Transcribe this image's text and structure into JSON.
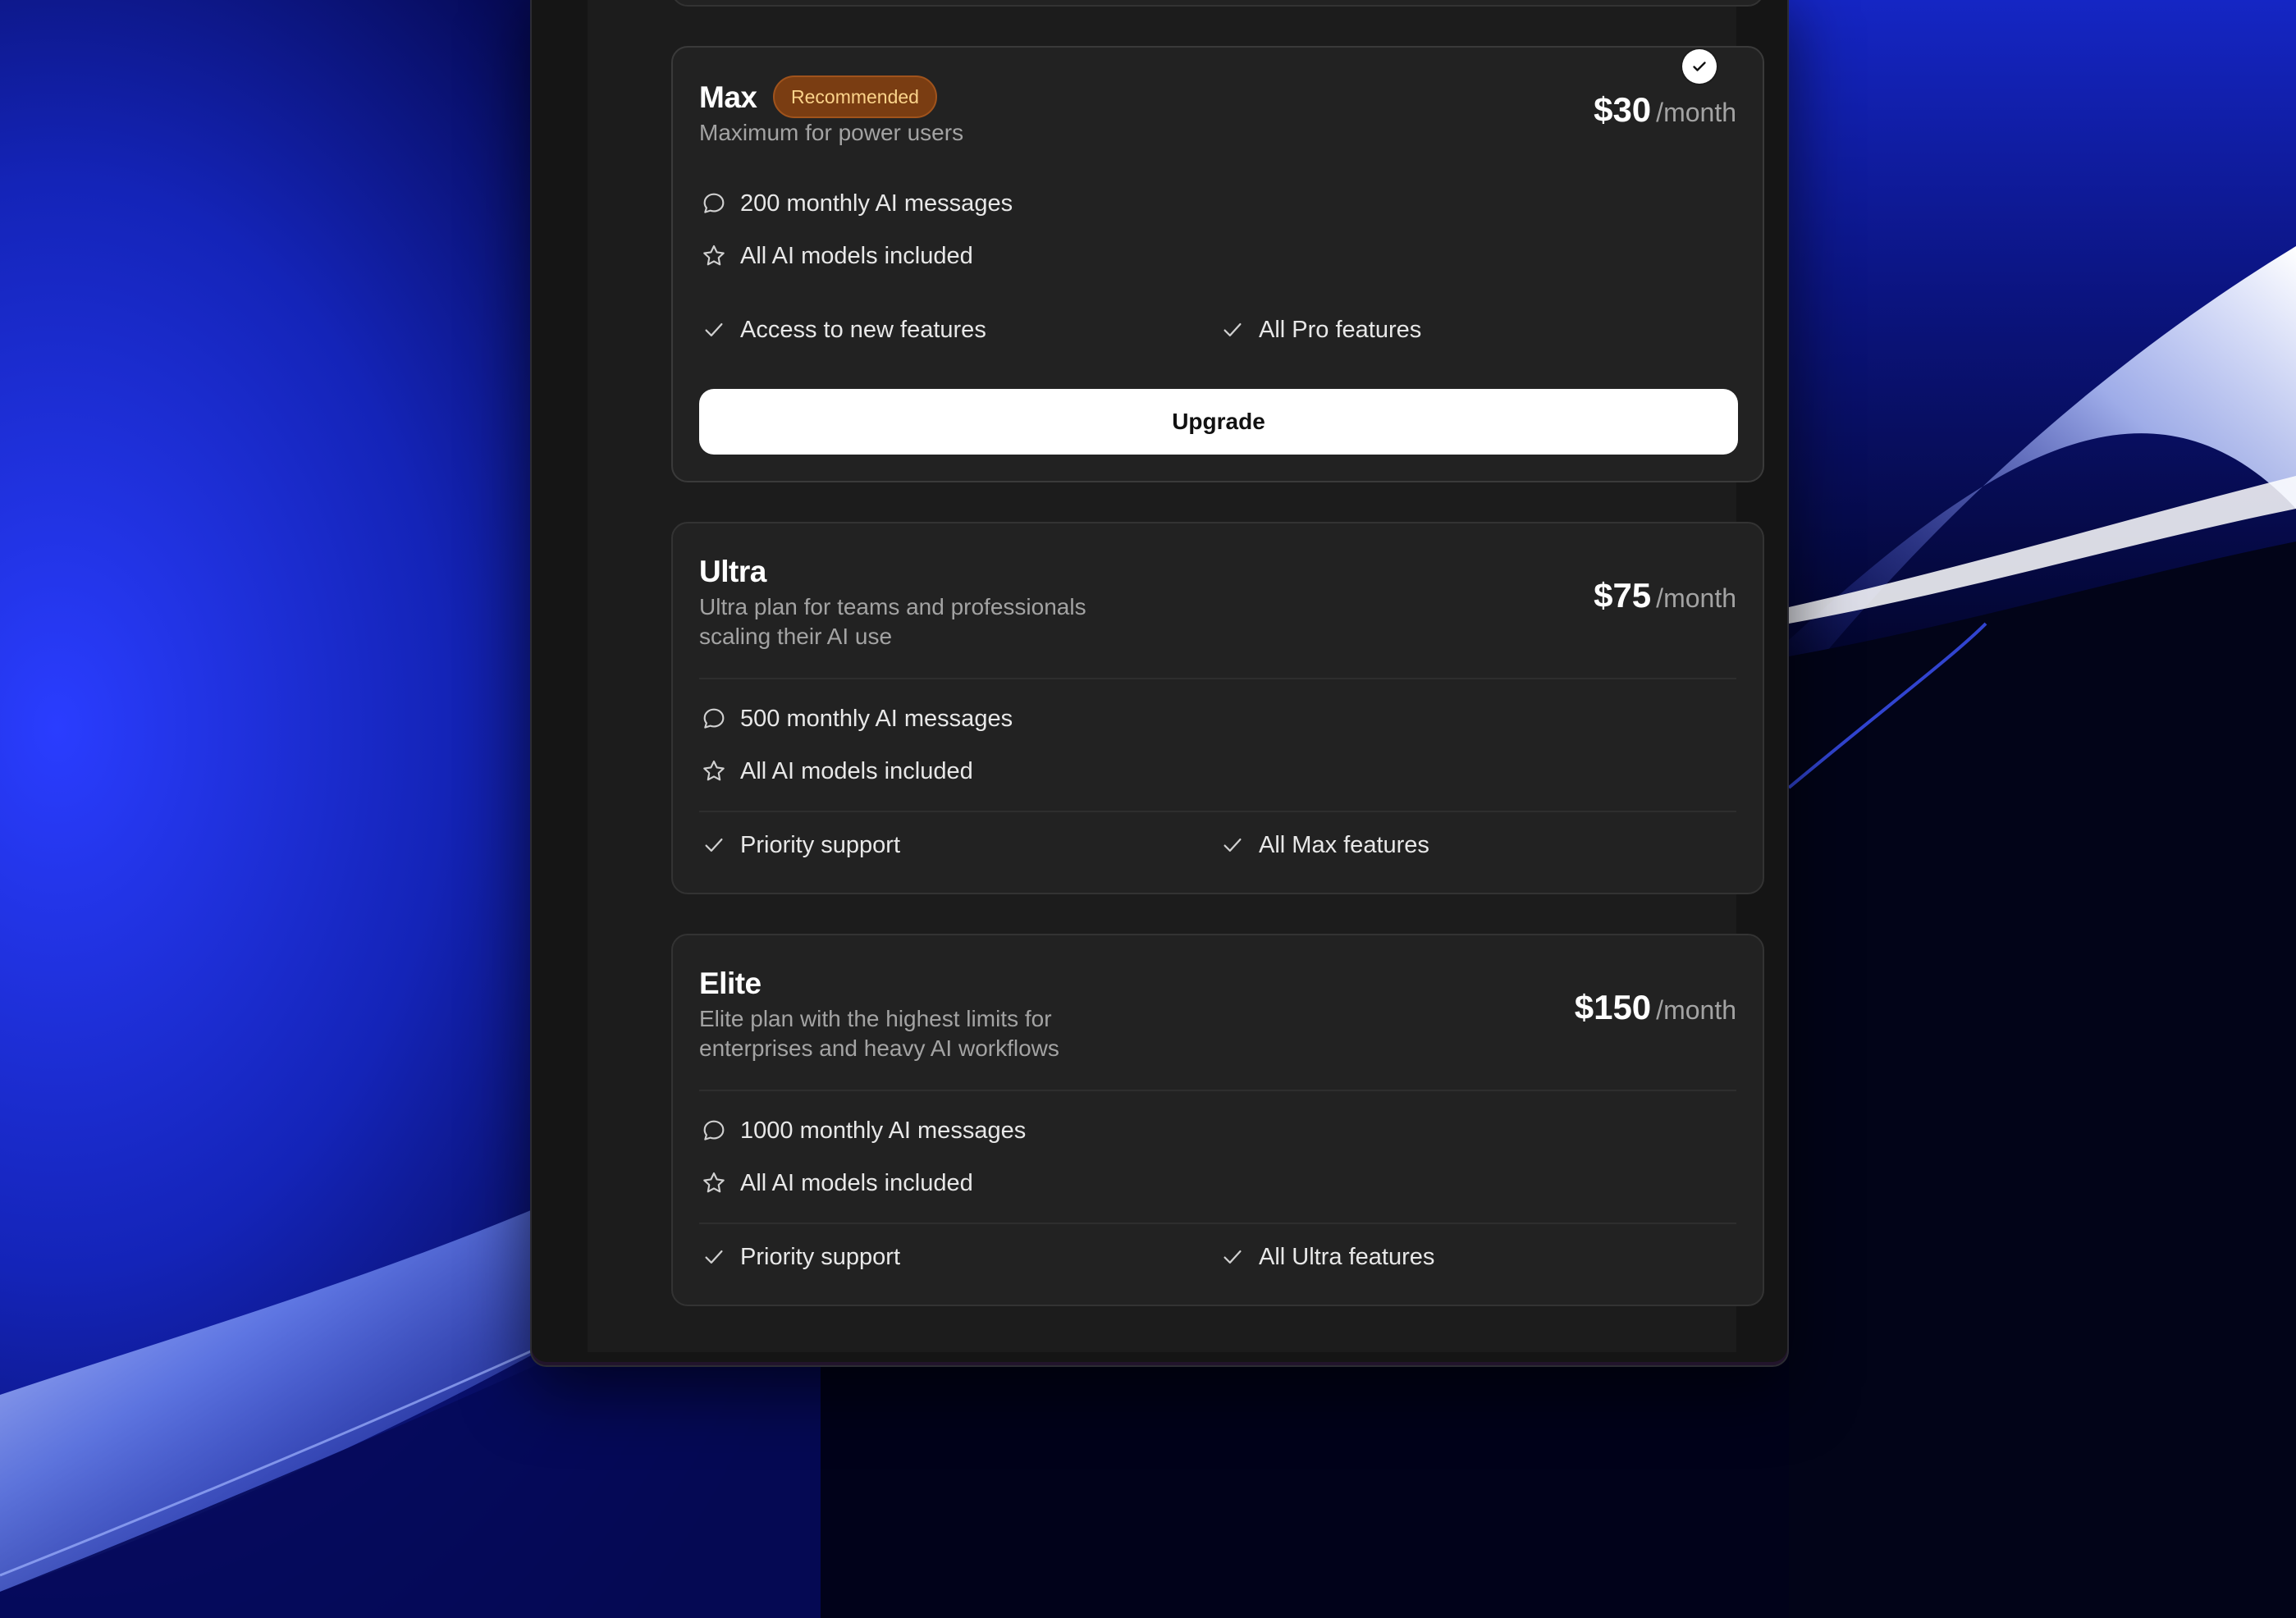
{
  "colors": {
    "wallpaper_deep": "#01021a",
    "wallpaper_blue": "#1a2fd0",
    "card_bg": "#222222",
    "badge_bg": "#7a3d12",
    "badge_text": "#fbd38a",
    "button_bg": "#ffffff"
  },
  "plans": [
    {
      "name": "Max",
      "badge": "Recommended",
      "description": "Maximum for power users",
      "price": "$30",
      "period": "/month",
      "selected": true,
      "features_primary": [
        {
          "icon": "chat-bubble-icon",
          "label": "200 monthly AI messages"
        },
        {
          "icon": "star-icon",
          "label": "All AI models included"
        }
      ],
      "features_secondary": [
        {
          "icon": "check-icon",
          "label": "Access to new features"
        },
        {
          "icon": "check-icon",
          "label": "All Pro features"
        }
      ],
      "cta": "Upgrade"
    },
    {
      "name": "Ultra",
      "description": "Ultra plan for teams and professionals scaling their AI use",
      "price": "$75",
      "period": "/month",
      "features_primary": [
        {
          "icon": "chat-bubble-icon",
          "label": "500 monthly AI messages"
        },
        {
          "icon": "star-icon",
          "label": "All AI models included"
        }
      ],
      "features_secondary": [
        {
          "icon": "check-icon",
          "label": "Priority support"
        },
        {
          "icon": "check-icon",
          "label": "All Max features"
        }
      ]
    },
    {
      "name": "Elite",
      "description": "Elite plan with the highest limits for enterprises and heavy AI workflows",
      "price": "$150",
      "period": "/month",
      "features_primary": [
        {
          "icon": "chat-bubble-icon",
          "label": "1000 monthly AI messages"
        },
        {
          "icon": "star-icon",
          "label": "All AI models included"
        }
      ],
      "features_secondary": [
        {
          "icon": "check-icon",
          "label": "Priority support"
        },
        {
          "icon": "check-icon",
          "label": "All Ultra features"
        }
      ]
    }
  ]
}
